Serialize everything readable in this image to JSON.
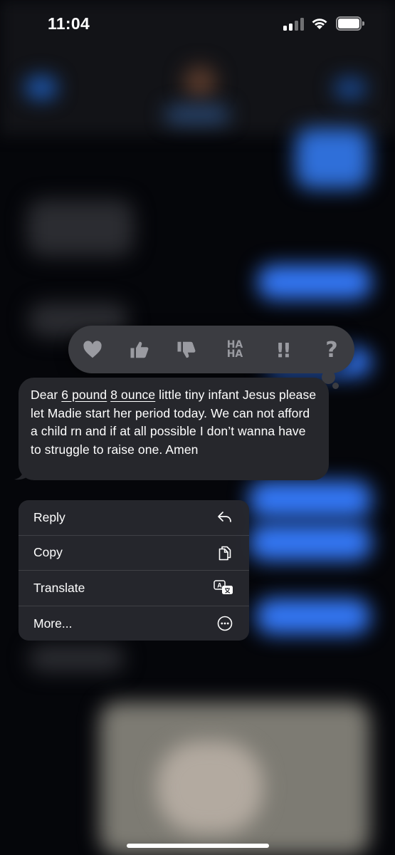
{
  "status_bar": {
    "time": "11:04",
    "signal_icon": "cellular-signal-icon",
    "wifi_icon": "wifi-icon",
    "battery_icon": "battery-icon"
  },
  "tapback": {
    "reactions": [
      {
        "name": "heart",
        "icon": "heart-icon"
      },
      {
        "name": "thumbs-up",
        "icon": "thumbs-up-icon"
      },
      {
        "name": "thumbs-down",
        "icon": "thumbs-down-icon"
      },
      {
        "name": "haha",
        "text": "HA\nHA"
      },
      {
        "name": "emphasize",
        "text": "!!"
      },
      {
        "name": "question",
        "text": "?"
      }
    ]
  },
  "message": {
    "part1": "Dear ",
    "link1": "6 pound",
    "part2": " ",
    "link2": "8 ounce",
    "part3": " little tiny infant Jesus please let Madie start her period today. We can not afford a child rn and if at all possible I don’t wanna have to struggle to raise one. Amen"
  },
  "context_menu": {
    "items": [
      {
        "label": "Reply",
        "icon": "reply-icon"
      },
      {
        "label": "Copy",
        "icon": "copy-icon"
      },
      {
        "label": "Translate",
        "icon": "translate-icon"
      },
      {
        "label": "More...",
        "icon": "more-icon"
      }
    ]
  },
  "colors": {
    "bubble_incoming": "#26272c",
    "menu_background": "#26282e",
    "tapback_background": "#3b3c41",
    "blurred_bubble_blue": "#3478f6"
  }
}
